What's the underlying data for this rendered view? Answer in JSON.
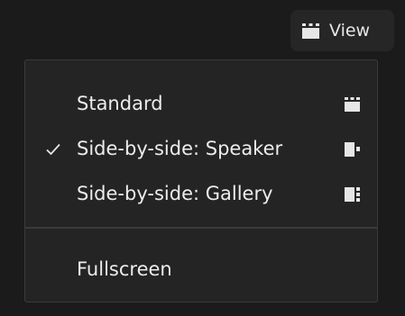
{
  "view_button": {
    "label": "View",
    "icon": "grid-layout-icon"
  },
  "menu": {
    "items": [
      {
        "label": "Standard",
        "checked": false,
        "icon": "standard-layout-icon"
      },
      {
        "label": "Side-by-side: Speaker",
        "checked": true,
        "icon": "side-by-side-speaker-icon"
      },
      {
        "label": "Side-by-side: Gallery",
        "checked": false,
        "icon": "side-by-side-gallery-icon"
      }
    ],
    "fullscreen": {
      "label": "Fullscreen"
    },
    "check_icon": "checkmark-icon"
  },
  "colors": {
    "background": "#1b1b1b",
    "menu_background": "#242424",
    "button_background": "#262626",
    "text": "#ececec",
    "divider": "#3a3a3a"
  }
}
